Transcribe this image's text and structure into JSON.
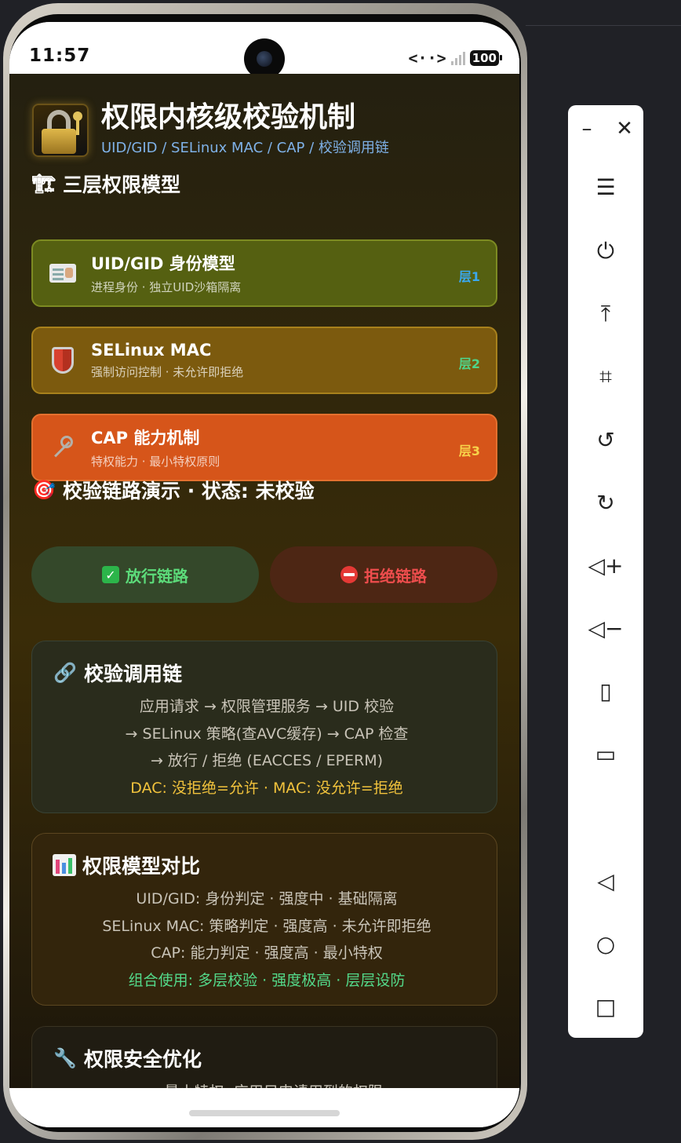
{
  "status_bar": {
    "time": "11:57",
    "network_icon": "<··>",
    "signal_x": "x",
    "battery": "100"
  },
  "app": {
    "title": "权限内核级校验机制",
    "subtitle": "UID/GID / SELinux MAC / CAP / 校验调用链",
    "section_layers": "三层权限模型",
    "layers": [
      {
        "name": "UID/GID 身份模型",
        "desc": "进程身份 · 独立UID沙箱隔离",
        "tag": "层1",
        "tag_color": "#3aa8f0"
      },
      {
        "name": "SELinux MAC",
        "desc": "强制访问控制 · 未允许即拒绝",
        "tag": "层2",
        "tag_color": "#4fd48a"
      },
      {
        "name": "CAP 能力机制",
        "desc": "特权能力 · 最小特权原则",
        "tag": "层3",
        "tag_color": "#f7d24a"
      }
    ],
    "section_demo": "校验链路演示 · 状态: 未校验",
    "btn_pass": "放行链路",
    "btn_deny": "拒绝链路",
    "chain": {
      "title": "校验调用链",
      "lines": [
        "应用请求 → 权限管理服务 → UID 校验",
        "→ SELinux 策略(查AVC缓存) → CAP 检查",
        "→ 放行 / 拒绝 (EACCES / EPERM)"
      ],
      "highlight": "DAC: 没拒绝=允许 · MAC: 没允许=拒绝"
    },
    "compare": {
      "title": "权限模型对比",
      "lines": [
        "UID/GID: 身份判定 · 强度中 · 基础隔离",
        "SELinux MAC: 策略判定 · 强度高 · 未允许即拒绝",
        "CAP: 能力判定 · 强度高 · 最小特权"
      ],
      "highlight": "组合使用: 多层校验 · 强度极高 · 层层设防"
    },
    "optimize": {
      "title": "权限安全优化",
      "lines": [
        "• 最小特权: 应用只申请用到的权限"
      ]
    }
  },
  "colors": {
    "accent_gold": "#f2c33c",
    "accent_green": "#53d98a",
    "pass_green": "#5cdb7a",
    "deny_red": "#ee4d4d"
  },
  "toolbar_icons": [
    "minimize-icon",
    "close-icon",
    "menu-icon",
    "power-icon",
    "upload-icon",
    "crop-icon",
    "rotate-left-icon",
    "rotate-right-icon",
    "volume-up-icon",
    "volume-down-icon",
    "shake-icon",
    "device-icon",
    "back-icon",
    "home-icon",
    "recents-icon"
  ]
}
